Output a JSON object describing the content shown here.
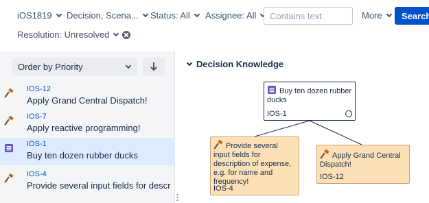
{
  "filters": {
    "project": "iOS1819",
    "types": "Decision, Scena...",
    "status": "Status: All",
    "assignee": "Assignee: All",
    "search_placeholder": "Contains text",
    "more": "More",
    "search_button": "Search",
    "resolution": "Resolution: Unresolved"
  },
  "left": {
    "order": "Order by Priority",
    "issues": [
      {
        "key": "IOS-12",
        "title": "Apply Grand Central Dispatch!",
        "icon": "hammer-icon"
      },
      {
        "key": "IOS-7",
        "title": "Apply reactive programming!",
        "icon": "hammer-icon"
      },
      {
        "key": "IOS-1",
        "title": "Buy ten dozen rubber ducks",
        "icon": "decision-icon"
      },
      {
        "key": "IOS-4",
        "title": "Provide several input fields for descripti...",
        "icon": "hammer-icon"
      }
    ]
  },
  "graph": {
    "section_title": "Decision Knowledge",
    "root": {
      "text": "Buy ten dozen rubber ducks",
      "key": "IOS-1"
    },
    "child1": {
      "text": "Provide several input fields for description of expense, e.g. for name and frequency!",
      "key": "IOS-4"
    },
    "child2": {
      "text": "Apply Grand Central Dispatch!",
      "key": "IOS-12"
    }
  },
  "colors": {
    "accent": "#0052cc",
    "selected_row": "#deebff",
    "alternative_node": "#fde0b6",
    "decision_icon": "#6554c0",
    "hammer_icon": "#c0601a"
  }
}
